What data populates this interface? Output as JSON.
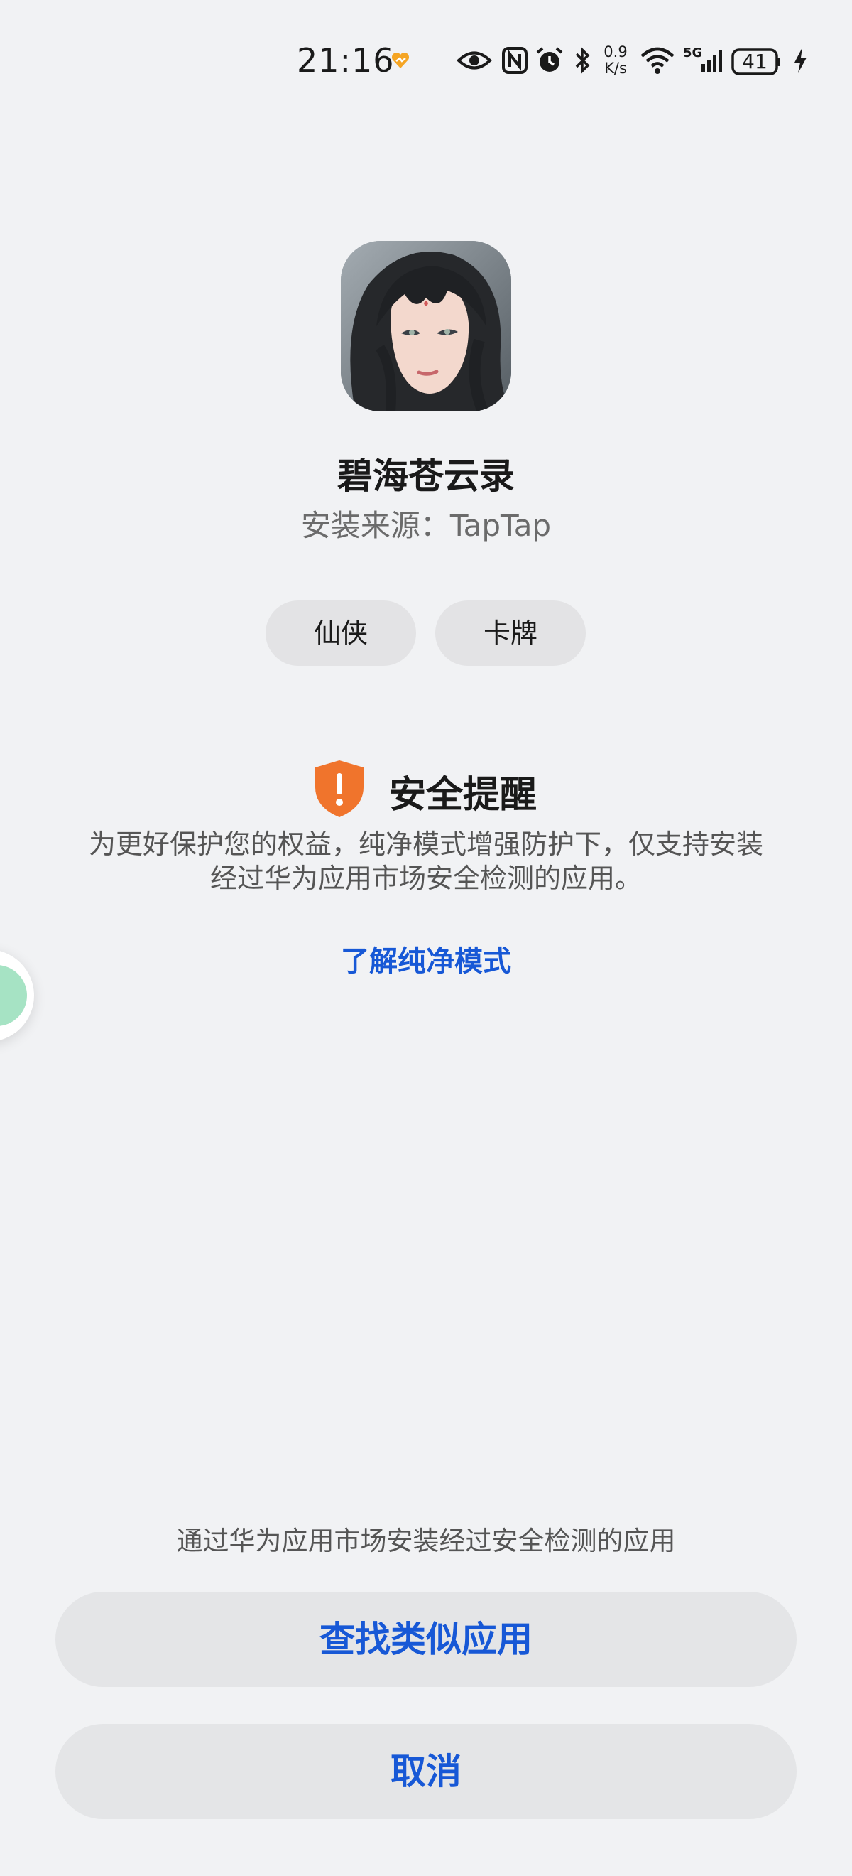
{
  "status_bar": {
    "time": "21:16",
    "network_speed_value": "0.9",
    "network_speed_unit": "K/s",
    "network_type": "5G",
    "battery_level": "41",
    "icons": [
      "heart-badge-icon",
      "eye-icon",
      "nfc-icon",
      "alarm-icon",
      "bluetooth-icon",
      "wifi-icon",
      "signal-icon",
      "battery-icon",
      "charging-icon"
    ]
  },
  "app": {
    "name": "碧海苍云录",
    "source": "安装来源：TapTap",
    "icon": "app-avatar-icon"
  },
  "tags": [
    "仙侠",
    "卡牌"
  ],
  "security": {
    "title": "安全提醒",
    "description_line1": "为更好保护您的权益，纯净模式增强防护下，仅支持安装",
    "description_line2": "经过华为应用市场安全检测的应用。",
    "learn_more": "了解纯净模式",
    "icon": "shield-warning-icon",
    "accent_color": "#f0742c"
  },
  "bottom": {
    "note": "通过华为应用市场安装经过安全检测的应用",
    "find_similar_label": "查找类似应用",
    "cancel_label": "取消"
  },
  "colors": {
    "background": "#f1f2f4",
    "link": "#1758d6",
    "button_bg": "#e4e5e7"
  }
}
